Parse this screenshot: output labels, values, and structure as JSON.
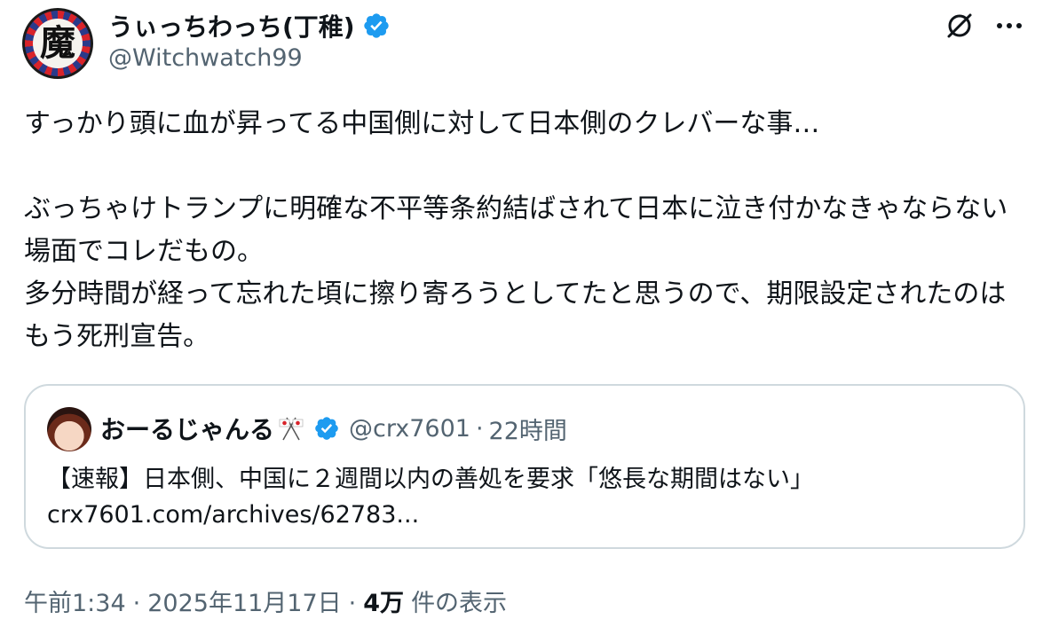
{
  "author": {
    "display_name": "うぃっちわっち(丁稚)",
    "handle": "@Witchwatch99",
    "avatar_glyph": "魔",
    "verified": true
  },
  "actions": {
    "grok_icon": "grok-icon",
    "more_icon": "more-icon"
  },
  "tweet": {
    "text": "すっかり頭に血が昇ってる中国側に対して日本側のクレバーな事…\n\nぶっちゃけトランプに明確な不平等条約結ばされて日本に泣き付かなきゃならない場面でコレだもの。\n多分時間が経って忘れた頃に擦り寄ろうとしてたと思うので、期限設定されたのはもう死刑宣告。"
  },
  "quote": {
    "display_name": "おーるじゃんる",
    "flag_icon": "crossed-flags-icon",
    "verified": true,
    "handle": "@crx7601",
    "separator": "·",
    "time": "22時間",
    "body": "【速報】日本側、中国に２週間以内の善処を要求「悠長な期間はない」\ncrx7601.com/archives/62783..."
  },
  "meta": {
    "time": "午前1:34",
    "separator": "·",
    "date": "2025年11月17日",
    "views_count": "4万",
    "views_label": "件の表示"
  },
  "colors": {
    "text_primary": "#0f1419",
    "text_secondary": "#536471",
    "verified_blue": "#1d9bf0",
    "border": "#cfd9de"
  }
}
